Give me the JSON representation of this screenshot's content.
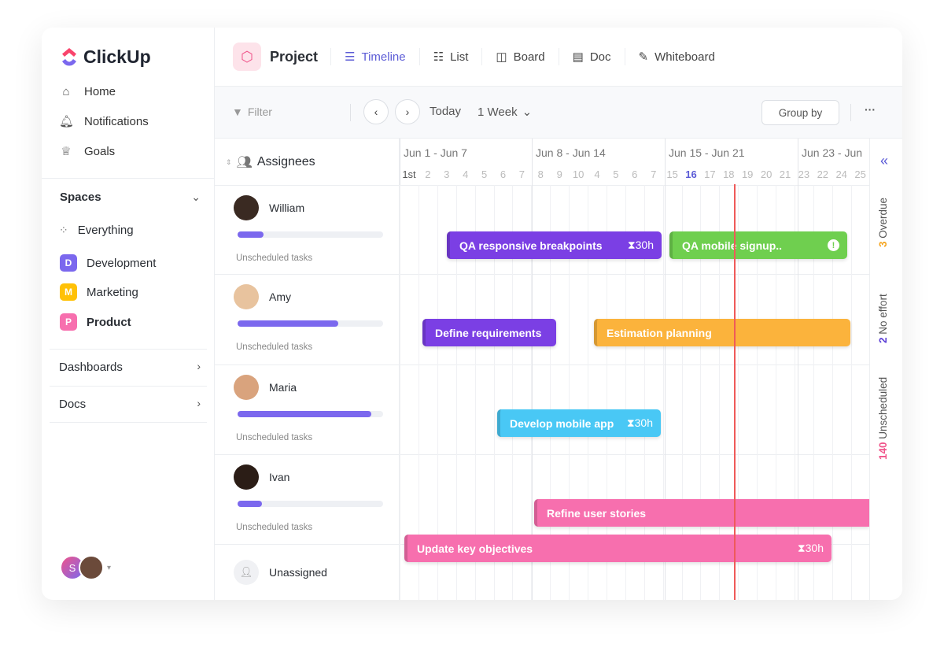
{
  "brand": "ClickUp",
  "sidebar": {
    "nav": [
      {
        "label": "Home",
        "icon": "home-icon"
      },
      {
        "label": "Notifications",
        "icon": "bell-icon"
      },
      {
        "label": "Goals",
        "icon": "trophy-icon"
      }
    ],
    "spaces_label": "Spaces",
    "everything": "Everything",
    "spaces": [
      {
        "letter": "D",
        "label": "Development",
        "color": "#7b68ee"
      },
      {
        "letter": "M",
        "label": "Marketing",
        "color": "#ffc107"
      },
      {
        "letter": "P",
        "label": "Product",
        "color": "#f76fae"
      }
    ],
    "dashboards": "Dashboards",
    "docs": "Docs",
    "user_initial": "S"
  },
  "header": {
    "project": "Project",
    "tabs": [
      "Timeline",
      "List",
      "Board",
      "Doc",
      "Whiteboard"
    ]
  },
  "toolbar": {
    "filter": "Filter",
    "today": "Today",
    "range": "1 Week",
    "group_by": "Group by",
    "more": "···"
  },
  "timeline": {
    "assignees_label": "Assignees",
    "weeks": [
      "Jun 1 - Jun 7",
      "Jun 8 - Jun 14",
      "Jun 15 - Jun 21",
      "Jun 23 - Jun"
    ],
    "days": [
      "1st",
      "2",
      "3",
      "4",
      "5",
      "6",
      "7",
      "8",
      "9",
      "10",
      "4",
      "5",
      "6",
      "7",
      "15",
      "16",
      "17",
      "18",
      "19",
      "20",
      "21",
      "23",
      "22",
      "24",
      "25"
    ],
    "today": "16",
    "rows": [
      {
        "name": "William",
        "progress": 0.18,
        "unscheduled": "Unscheduled tasks"
      },
      {
        "name": "Amy",
        "progress": 0.69,
        "unscheduled": "Unscheduled tasks"
      },
      {
        "name": "Maria",
        "progress": 0.92,
        "unscheduled": "Unscheduled tasks"
      },
      {
        "name": "Ivan",
        "progress": 0.17,
        "unscheduled": "Unscheduled tasks"
      }
    ],
    "unassigned": "Unassigned",
    "tasks": [
      {
        "title": "QA responsive breakpoints",
        "effort": "30h",
        "color": "#7b3fe4"
      },
      {
        "title": "QA mobile signup..",
        "color": "#6fcf4f"
      },
      {
        "title": "Define requirements",
        "color": "#7b3fe4"
      },
      {
        "title": "Estimation planning",
        "color": "#fbb33c"
      },
      {
        "title": "Develop mobile app",
        "effort": "30h",
        "color": "#49c8f5"
      },
      {
        "title": "Refine user stories",
        "color": "#f76fae"
      },
      {
        "title": "Update key objectives",
        "effort": "30h",
        "color": "#f76fae"
      }
    ]
  },
  "side_panel": {
    "overdue_count": "3",
    "overdue": "Overdue",
    "no_effort_count": "2",
    "no_effort": "No effort",
    "unscheduled_count": "140",
    "unscheduled": "Unscheduled"
  }
}
